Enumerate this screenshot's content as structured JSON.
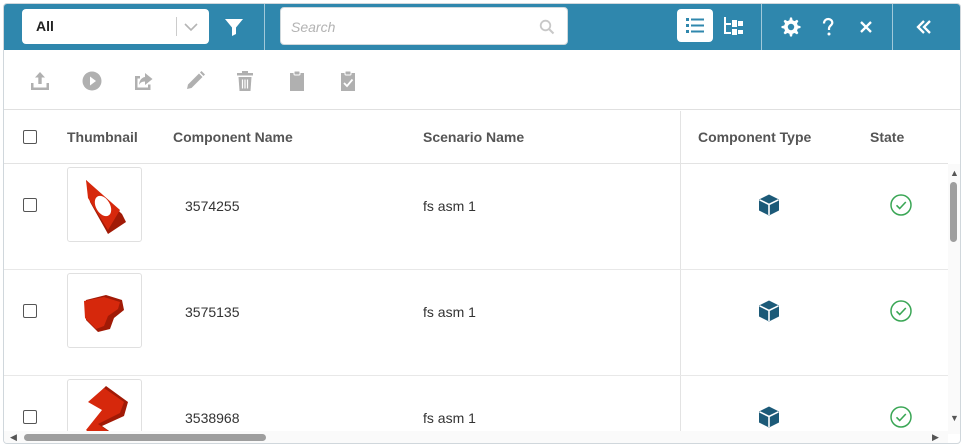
{
  "filter": {
    "selected": "All"
  },
  "search": {
    "placeholder": "Search",
    "value": ""
  },
  "columns": {
    "thumbnail": "Thumbnail",
    "component_name": "Component Name",
    "scenario_name": "Scenario Name",
    "component_type": "Component Type",
    "state": "State"
  },
  "rows": [
    {
      "component_name": "3574255",
      "scenario_name": "fs asm 1",
      "component_type_icon": "part-cube-icon",
      "state_icon": "check-circle-icon"
    },
    {
      "component_name": "3575135",
      "scenario_name": "fs asm 1",
      "component_type_icon": "part-cube-icon",
      "state_icon": "check-circle-icon"
    },
    {
      "component_name": "3538968",
      "scenario_name": "fs asm 1",
      "component_type_icon": "part-cube-icon",
      "state_icon": "check-circle-icon"
    }
  ],
  "colors": {
    "topbar": "#2f87ad",
    "part_red": "#d6280c",
    "type_icon": "#1c5a78",
    "state_ok": "#3aa655",
    "disabled_icon": "#b0b0b0"
  }
}
